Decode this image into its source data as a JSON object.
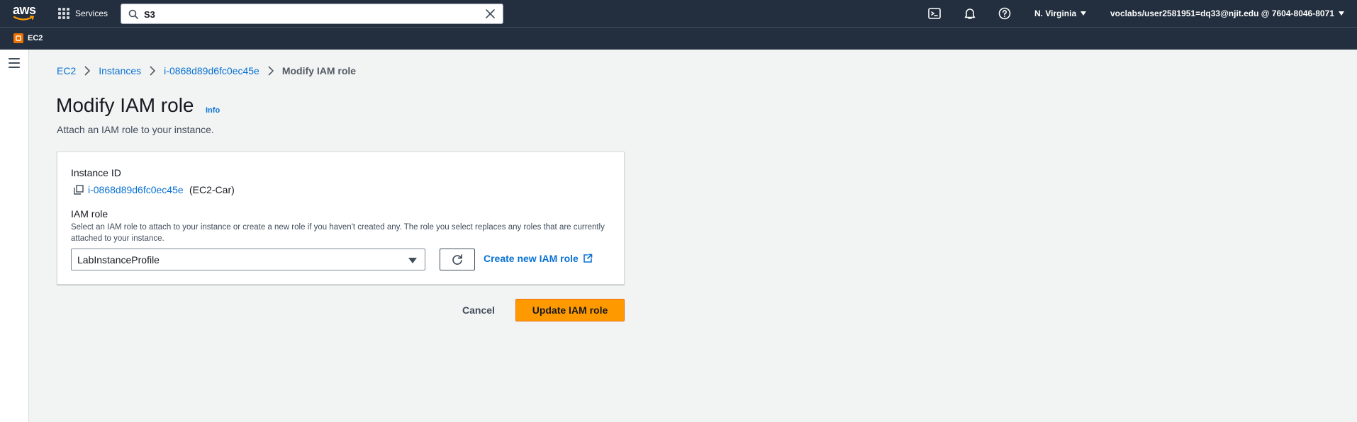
{
  "topnav": {
    "logo_text": "aws",
    "services_label": "Services",
    "search": {
      "value": "S3",
      "placeholder": "Search"
    },
    "region": "N. Virginia",
    "account": "voclabs/user2581951=dq33@njit.edu @ 7604-8046-8071"
  },
  "favorites": [
    {
      "label": "EC2",
      "icon": "ec2-service-icon",
      "color": "#ed7100"
    }
  ],
  "breadcrumb": {
    "items": [
      "EC2",
      "Instances",
      "i-0868d89d6fc0ec45e"
    ],
    "current": "Modify IAM role"
  },
  "header": {
    "title": "Modify IAM role",
    "info": "Info",
    "description": "Attach an IAM role to your instance."
  },
  "form": {
    "instance_id_label": "Instance ID",
    "instance_id": "i-0868d89d6fc0ec45e",
    "instance_name": "(EC2-Car)",
    "iam_role_label": "IAM role",
    "iam_role_hint": "Select an IAM role to attach to your instance or create a new role if you haven't created any. The role you select replaces any roles that are currently attached to your instance.",
    "iam_role_selected": "LabInstanceProfile",
    "create_link": "Create new IAM role"
  },
  "actions": {
    "cancel": "Cancel",
    "submit": "Update IAM role"
  },
  "colors": {
    "nav_bg": "#232f3e",
    "link": "#0972d3",
    "primary": "#ff9900",
    "page_bg": "#f2f3f3"
  }
}
